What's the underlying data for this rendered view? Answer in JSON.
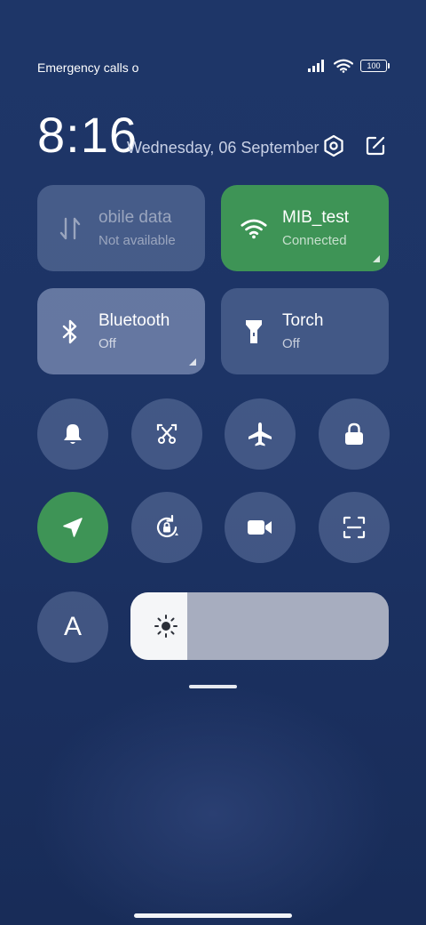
{
  "status_bar": {
    "carrier_text": "Emergency calls o",
    "battery_level": "100",
    "icons": [
      "signal-icon",
      "wifi-icon",
      "battery-icon"
    ]
  },
  "header": {
    "time": "8:16",
    "date": "Wednesday, 06 September",
    "icons": [
      "settings-icon",
      "edit-icon"
    ]
  },
  "tiles": {
    "mobile_data": {
      "title": "obile data",
      "subtitle": "Not available",
      "icon": "data-arrows-icon",
      "state": "disabled"
    },
    "wifi": {
      "title": "MIB_test",
      "subtitle": "Connected",
      "icon": "wifi-icon",
      "state": "on",
      "color": "#3e9456"
    },
    "bluetooth": {
      "title": "Bluetooth",
      "subtitle": "Off",
      "icon": "bluetooth-icon",
      "state": "off"
    },
    "torch": {
      "title": "Torch",
      "subtitle": "Off",
      "icon": "torch-icon",
      "state": "off"
    }
  },
  "toggles": [
    {
      "icon": "bell-icon",
      "state": "off"
    },
    {
      "icon": "screenshot-icon",
      "state": "off"
    },
    {
      "icon": "airplane-icon",
      "state": "off"
    },
    {
      "icon": "lock-icon",
      "state": "off"
    },
    {
      "icon": "location-icon",
      "state": "on"
    },
    {
      "icon": "rotation-lock-icon",
      "state": "off"
    },
    {
      "icon": "video-camera-icon",
      "state": "off"
    },
    {
      "icon": "scan-icon",
      "state": "off"
    },
    {
      "icon": "font-size-icon",
      "label": "A",
      "state": "off"
    }
  ],
  "brightness": {
    "icon": "sun-icon",
    "level": 0.22
  },
  "colors": {
    "accent": "#3e9456",
    "background": "#1d3466"
  }
}
